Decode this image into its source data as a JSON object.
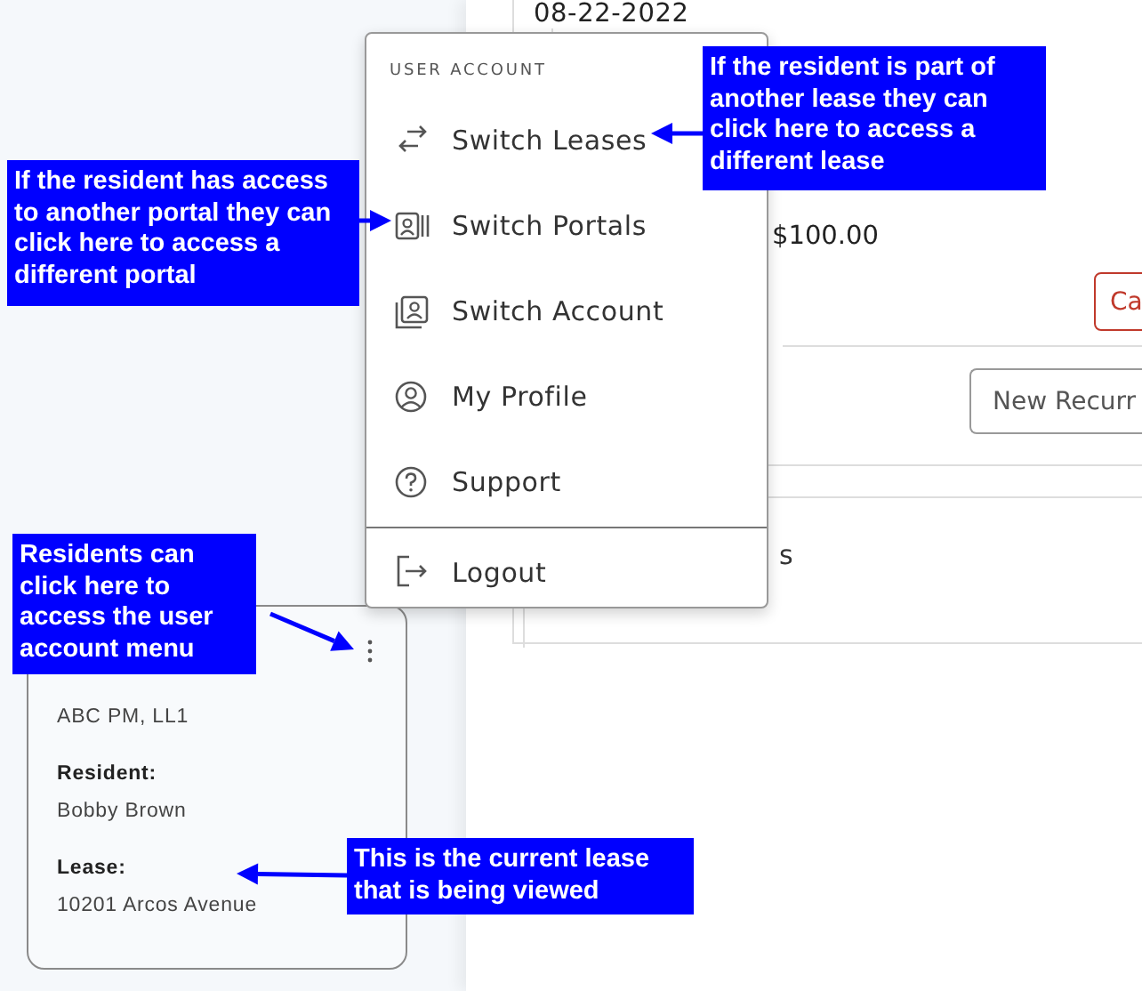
{
  "main": {
    "date": "08-22-2022",
    "amount": "$100.00",
    "cancel_button": "Ca",
    "new_recurring_button": "New Recurr",
    "section_title": "s"
  },
  "lease_card": {
    "company": "ABC PM, LL1",
    "resident_label": "Resident:",
    "resident": "Bobby Brown",
    "lease_label": "Lease:",
    "lease": "10201 Arcos Avenue"
  },
  "user_menu": {
    "header": "USER ACCOUNT",
    "items": [
      {
        "label": "Switch Leases"
      },
      {
        "label": "Switch Portals"
      },
      {
        "label": "Switch Account"
      },
      {
        "label": "My Profile"
      },
      {
        "label": "Support"
      }
    ],
    "footer_item": {
      "label": "Logout"
    }
  },
  "callouts": [
    {
      "text": "If the resident is part of another lease they can click here to access a different lease"
    },
    {
      "text": "If the resident has access to another portal they can click here to access a different portal"
    },
    {
      "text": "Residents can click here to access the user account menu"
    },
    {
      "text": "This is the current lease that is being viewed"
    }
  ]
}
